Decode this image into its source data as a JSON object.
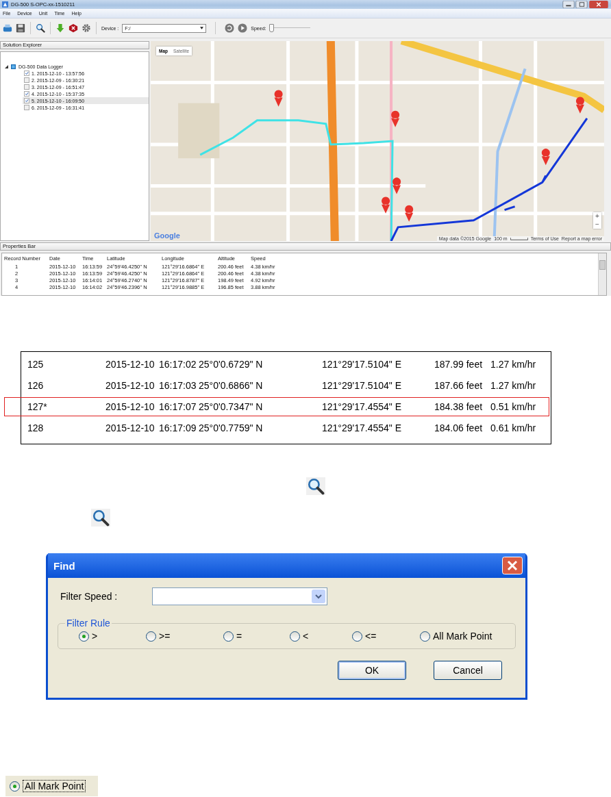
{
  "app_window": {
    "title": "DG-500 S-OPC-xx-1510211",
    "menu": [
      "File",
      "Device",
      "Unit",
      "Time",
      "Help"
    ],
    "toolbar": {
      "device_label": "Device :",
      "device_value": "F:/",
      "speed_label": "Speed:",
      "speed_slider": {
        "level": 0
      }
    },
    "solution_explorer": {
      "title": "Solution Explorer",
      "root": {
        "label": "DG-500 Data Logger",
        "expanded": true,
        "children": [
          {
            "label": "1. 2015-12-10 - 13:57:56",
            "checked": true,
            "selected": false
          },
          {
            "label": "2. 2015-12-09 - 16:30:21",
            "checked": false,
            "selected": false
          },
          {
            "label": "3. 2015-12-09 - 16:51:47",
            "checked": false,
            "selected": false
          },
          {
            "label": "4. 2015-12-10 - 15:37:35",
            "checked": true,
            "selected": false
          },
          {
            "label": "5. 2015-12-10 - 16:09:50",
            "checked": true,
            "selected": true
          },
          {
            "label": "6. 2015-12-09 - 16:31:41",
            "checked": false,
            "selected": false
          }
        ]
      }
    },
    "map": {
      "tabs": [
        {
          "label": "Map",
          "selected": true
        },
        {
          "label": "Satellite",
          "selected": false
        }
      ],
      "zoom_in": "+",
      "zoom_out": "−",
      "logo": "Google",
      "attribution": "Map data ©2015 Google",
      "scale": "100 m",
      "terms": "Terms of Use",
      "report": "Report a map error"
    },
    "properties_bar": {
      "title": "Properties Bar",
      "columns": [
        "Record Number",
        "Date",
        "Time",
        "Latitude",
        "Longitude",
        "Altitude",
        "Speed"
      ],
      "rows": [
        [
          "1",
          "2015-12-10",
          "16:13:59",
          "24°59'46.4250'' N",
          "121°29'16.6864'' E",
          "200.46 feet",
          "4.38 km/hr"
        ],
        [
          "2",
          "2015-12-10",
          "16:13:59",
          "24°59'46.4250'' N",
          "121°29'16.6864'' E",
          "200.46 feet",
          "4.38 km/hr"
        ],
        [
          "3",
          "2015-12-10",
          "16:14:01",
          "24°59'46.2740'' N",
          "121°29'16.8787'' E",
          "198.49 feet",
          "4.92 km/hr"
        ],
        [
          "4",
          "2015-12-10",
          "16:14:02",
          "24°59'46.2396'' N",
          "121°29'16.9885'' E",
          "196.85 feet",
          "3.88 km/hr"
        ]
      ]
    }
  },
  "record_excerpt": {
    "rows": [
      {
        "cells": [
          "125",
          "2015-12-10",
          "16:17:02",
          "25°0'0.6729\" N",
          "121°29'17.5104\" E",
          "187.99 feet",
          "1.27 km/hr"
        ],
        "highlighted": false
      },
      {
        "cells": [
          "126",
          "2015-12-10",
          "16:17:03",
          "25°0'0.6866\" N",
          "121°29'17.5104\" E",
          "187.66 feet",
          "1.27 km/hr"
        ],
        "highlighted": false
      },
      {
        "cells": [
          "127*",
          "2015-12-10",
          "16:17:07",
          "25°0'0.7347\" N",
          "121°29'17.4554\" E",
          "184.38 feet",
          "0.51 km/hr"
        ],
        "highlighted": true
      },
      {
        "cells": [
          "128",
          "2015-12-10",
          "16:17:09",
          "25°0'0.7759\" N",
          "121°29'17.4554\" E",
          "184.06 feet",
          "0.61 km/hr"
        ],
        "highlighted": false
      }
    ]
  },
  "find_dialog": {
    "title": "Find",
    "filter_speed_label": "Filter Speed :",
    "filter_rule_label": "Filter Rule",
    "rules": [
      {
        "label": ">",
        "selected": true
      },
      {
        "label": ">=",
        "selected": false
      },
      {
        "label": "=",
        "selected": false
      },
      {
        "label": "<",
        "selected": false
      },
      {
        "label": "<=",
        "selected": false
      },
      {
        "label": "All Mark Point",
        "selected": false
      }
    ],
    "buttons": [
      "OK",
      "Cancel"
    ]
  },
  "all_mark_point_example": {
    "label": "All Mark Point",
    "selected": true
  }
}
